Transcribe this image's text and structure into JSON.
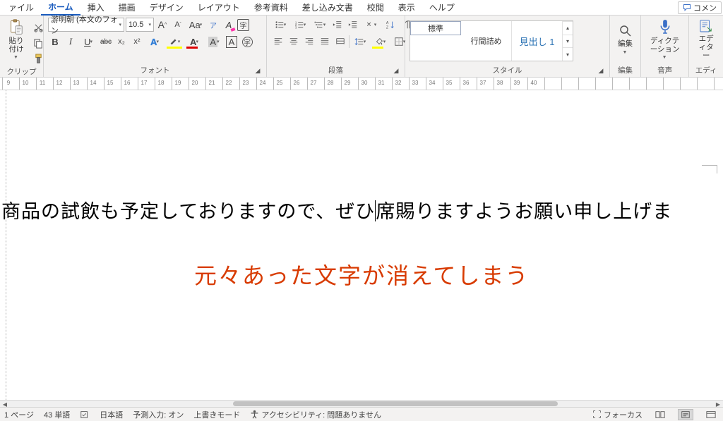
{
  "menu": {
    "tabs": [
      "ァイル",
      "ホーム",
      "挿入",
      "描画",
      "デザイン",
      "レイアウト",
      "参考資料",
      "差し込み文書",
      "校閲",
      "表示",
      "ヘルプ"
    ],
    "active_index": 1,
    "comment_btn": "コメン"
  },
  "ribbon": {
    "clipboard": {
      "label": "クリップボード",
      "paste": "貼り付け"
    },
    "font": {
      "label": "フォント",
      "name": "游明朝 (本文のフォン",
      "size": "10.5",
      "inc": "A",
      "dec": "A",
      "case": "Aa",
      "clear": "A",
      "bold": "B",
      "italic": "I",
      "under": "U",
      "strike": "abc",
      "sub": "x₂",
      "sup": "x²",
      "effects": "A",
      "highlight": "ab",
      "color": "A",
      "fmt": "A",
      "ruby": "ア",
      "enclose": "字"
    },
    "para": {
      "label": "段落"
    },
    "styles": {
      "label": "スタイル",
      "items": [
        "標準",
        "行間詰め",
        "見出し 1"
      ]
    },
    "edit": {
      "label": "編集",
      "btn": "編集"
    },
    "dictation": {
      "label": "音声",
      "btn": "ディクテーション"
    },
    "editor": {
      "label": "エディ",
      "btn": "エディター"
    }
  },
  "ruler": {
    "start": 9,
    "end": 40
  },
  "document": {
    "before": "商品の試飲も予定しておりますので、ぜひ",
    "after": "席賜りますようお願い申し上げま",
    "annotation": "元々あった文字が消えてしまう"
  },
  "status": {
    "page": "1 ページ",
    "words": "43 単語",
    "lang": "日本語",
    "predict": "予測入力: オン",
    "overwrite": "上書きモード",
    "access": "アクセシビリティ: 問題ありません",
    "focus": "フォーカス"
  }
}
